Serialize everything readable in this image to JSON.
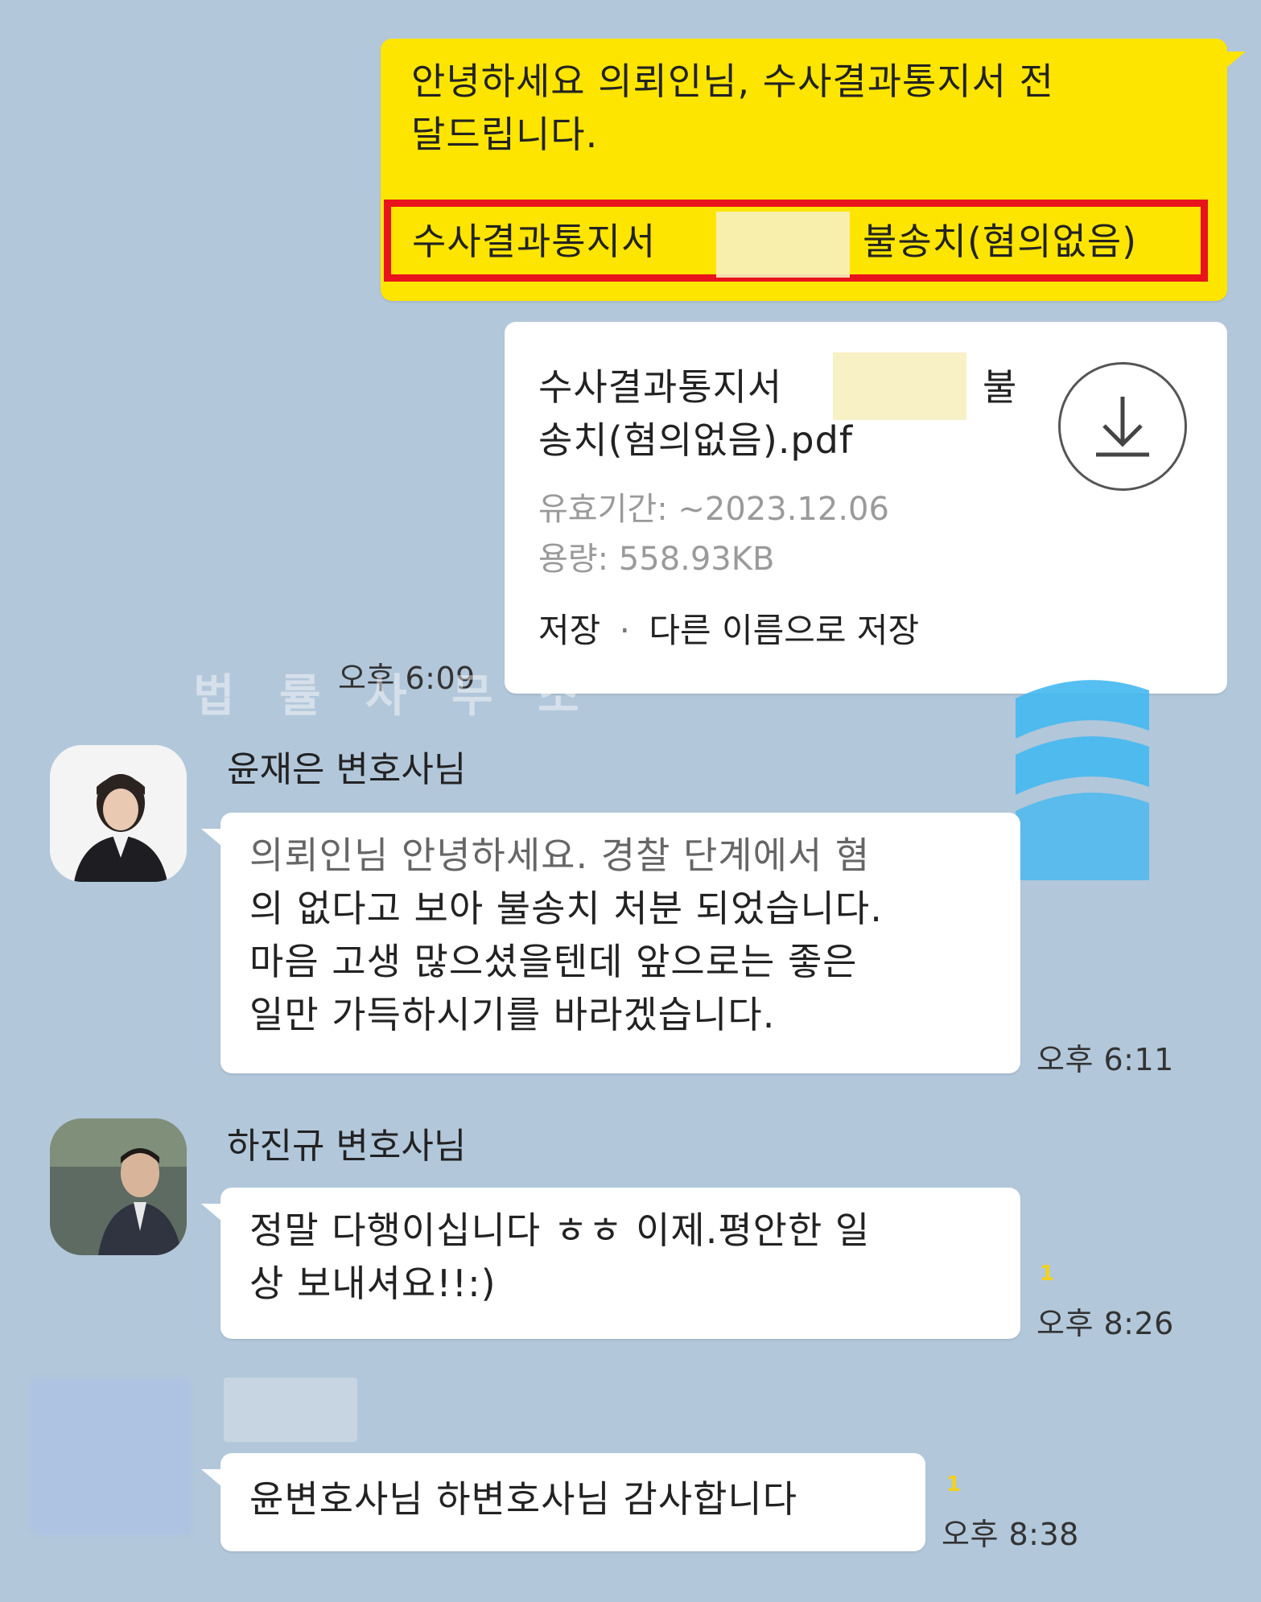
{
  "msg1": {
    "line1": "안녕하세요 의뢰인님, 수사결과통지서 전",
    "line2": "달드립니다.",
    "hl_left": "수사결과통지서",
    "hl_right": "불송치(혐의없음)"
  },
  "file": {
    "name_line1_left": "수사결과통지서",
    "name_line1_right": "불",
    "name_line2": "송치(혐의없음).pdf",
    "expiry": "유효기간: ~2023.12.06",
    "size": "용량: 558.93KB",
    "save": "저장",
    "sep": "·",
    "save_as": "다른 이름으로 저장",
    "time": "오후 6:09"
  },
  "watermark": {
    "top": "법  률  사  무  소"
  },
  "msg2": {
    "sender": "윤재은 변호사님",
    "line1": "의뢰인님 안녕하세요. 경찰 단계에서 혐",
    "line2": "의 없다고 보아 불송치 처분 되었습니다.",
    "line3": " 마음 고생 많으셨을텐데 앞으로는 좋은",
    "line4": " 일만 가득하시기를 바라겠습니다.",
    "time": "오후 6:11"
  },
  "msg3": {
    "sender": "하진규 변호사님",
    "line1": "정말 다행이십니다 ㅎㅎ 이제.평안한 일",
    "line2": "상 보내셔요!!:)",
    "unread": "1",
    "time": "오후 8:26"
  },
  "msg4": {
    "line1": "윤변호사님 하변호사님 감사합니다",
    "unread": "1",
    "time": "오후 8:38"
  },
  "colors": {
    "background": "#b2c7da",
    "my_bubble": "#fee500",
    "other_bubble": "#ffffff",
    "highlight_box": "#e8131b",
    "watermark_blue": "#44b8f0"
  }
}
